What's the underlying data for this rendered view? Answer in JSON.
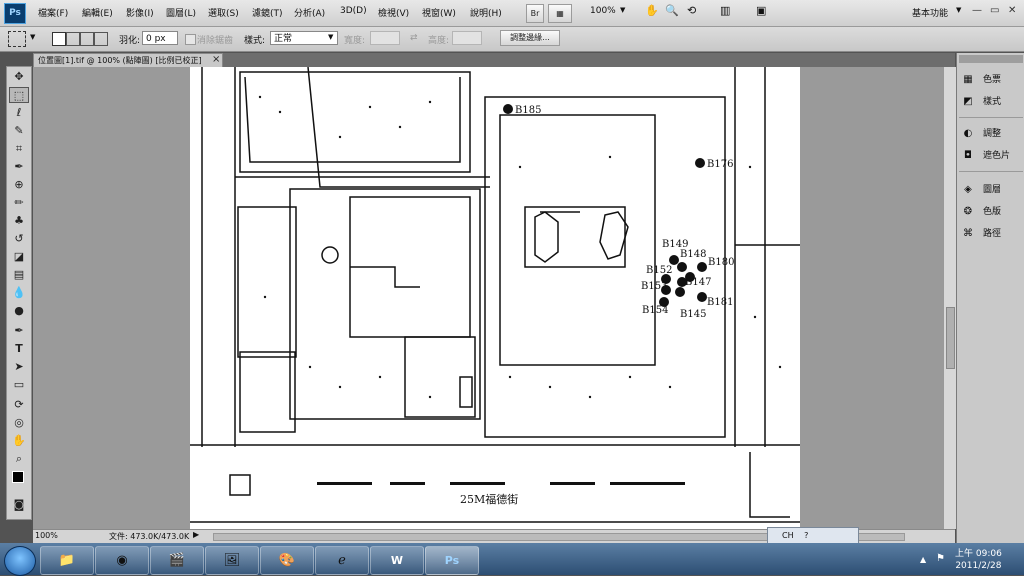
{
  "app": {
    "logo": "Ps"
  },
  "menu": [
    "檔案(F)",
    "編輯(E)",
    "影像(I)",
    "圖層(L)",
    "選取(S)",
    "濾鏡(T)",
    "分析(A)",
    "3D(D)",
    "檢視(V)",
    "視窗(W)",
    "說明(H)"
  ],
  "toolbar": {
    "br_label": "Br",
    "zoom": "100%",
    "workspace": "基本功能"
  },
  "window_controls": {
    "min": "—",
    "restore": "▭",
    "close": "✕"
  },
  "options": {
    "feather_label": "羽化:",
    "feather_value": "0 px",
    "antialias_label": "消除鋸齒",
    "style_label": "樣式:",
    "style_value": "正常",
    "width_label": "寬度:",
    "height_label": "高度:",
    "refine_button": "調整邊緣..."
  },
  "document": {
    "tab_title": "位置圖[1].tif @ 100% (點陣圖) [比例已校正]",
    "close": "×",
    "zoom": "100%",
    "file_info": "文件: 473.0K/473.0K"
  },
  "map": {
    "street_label": "25M福德街",
    "labels": [
      "B185",
      "B176",
      "B149",
      "B148",
      "B180",
      "B152",
      "B153",
      "B147",
      "B181",
      "B154",
      "B145"
    ]
  },
  "panels": [
    {
      "label": "色票",
      "icon": "swatches-icon"
    },
    {
      "label": "樣式",
      "icon": "styles-icon"
    },
    {
      "label": "調整",
      "icon": "adjustments-icon"
    },
    {
      "label": "遮色片",
      "icon": "masks-icon"
    },
    {
      "label": "圖層",
      "icon": "layers-icon"
    },
    {
      "label": "色版",
      "icon": "channels-icon"
    },
    {
      "label": "路徑",
      "icon": "paths-icon"
    }
  ],
  "taskbar": {
    "clock_time": "上午 09:06",
    "clock_date": "2011/2/28",
    "ime": "CH"
  },
  "colors": {
    "ps_blue": "#0a3d6e",
    "taskbar": "#2d4e73",
    "workspace_gray": "#535353"
  }
}
